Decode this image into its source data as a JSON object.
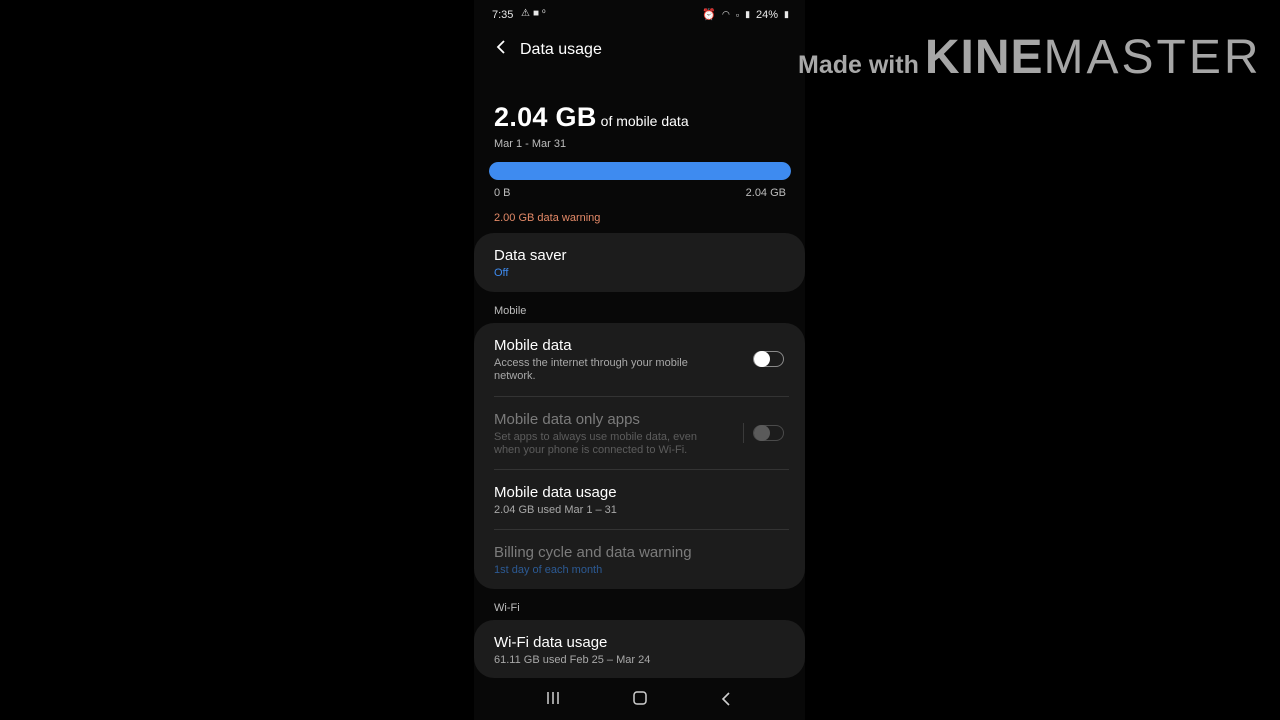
{
  "status_bar": {
    "time": "7:35",
    "left_icons": [
      "warning-icon",
      "video-icon",
      "data-speed-icon"
    ],
    "right_icons": [
      "alarm-icon",
      "wifi-icon",
      "volte-icon",
      "signal-icon"
    ],
    "battery": "24%"
  },
  "header": {
    "title": "Data usage"
  },
  "usage": {
    "amount": "2.04 GB",
    "suffix": "of mobile data",
    "period": "Mar 1 - Mar 31",
    "bar_min": "0 B",
    "bar_max": "2.04 GB",
    "fill_fraction": 1.0,
    "warning": "2.00 GB data warning"
  },
  "data_saver": {
    "title": "Data saver",
    "status": "Off"
  },
  "mobile_section": {
    "label": "Mobile",
    "items": [
      {
        "title": "Mobile data",
        "subtitle": "Access the internet through your mobile network.",
        "toggle": false
      },
      {
        "title": "Mobile data only apps",
        "subtitle": "Set apps to always use mobile data, even when your phone is connected to Wi-Fi.",
        "toggle": false,
        "disabled": true
      },
      {
        "title": "Mobile data usage",
        "subtitle": "2.04 GB used Mar 1 – 31"
      },
      {
        "title": "Billing cycle and data warning",
        "subtitle": "1st day of each month",
        "disabled": true
      }
    ]
  },
  "wifi_section": {
    "label": "Wi-Fi",
    "items": [
      {
        "title": "Wi-Fi data usage",
        "subtitle": "61.11 GB used Feb 25 – Mar 24"
      }
    ]
  },
  "nav": {
    "icons": [
      "recents-icon",
      "home-icon",
      "back-nav-icon"
    ]
  },
  "watermark": {
    "prefix": "Made with",
    "brand_bold": "KINE",
    "brand_light": "MASTER"
  },
  "colors": {
    "accent": "#3e8bf0",
    "warning": "#e48a68",
    "card": "#1c1c1c",
    "background": "#080808"
  }
}
